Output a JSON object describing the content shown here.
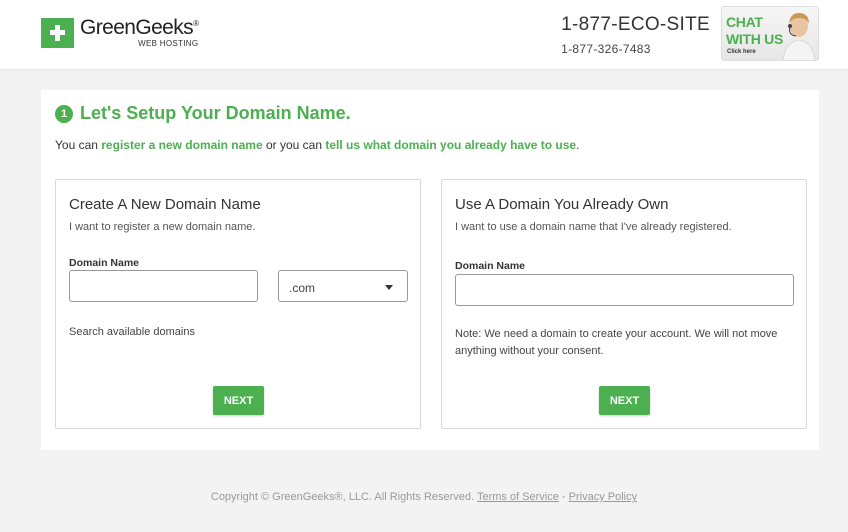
{
  "header": {
    "brand": "GreenGeeks",
    "brand_mark": "®",
    "brand_sub": "WEB HOSTING",
    "phone_main": "1-877-ECO-SITE",
    "phone_alt": "1-877-326-7483",
    "chat_line1": "CHAT",
    "chat_line2": "WITH US",
    "chat_click": "Click here"
  },
  "setup": {
    "step_number": "1",
    "heading": "Let's Setup Your Domain Name.",
    "intro_prefix": "You can ",
    "intro_link1": "register a new domain name",
    "intro_middle": " or you can ",
    "intro_link2": "tell us what domain you already have to use",
    "intro_suffix": "."
  },
  "new_domain": {
    "title": "Create A New Domain Name",
    "subtitle": "I want to register a new domain name.",
    "field_label": "Domain Name",
    "field_value": "",
    "tld_selected": ".com",
    "search_text": "Search available domains",
    "next_label": "NEXT"
  },
  "own_domain": {
    "title": "Use A Domain You Already Own",
    "subtitle": "I want to use a domain name that I've already registered.",
    "field_label": "Domain Name",
    "field_value": "",
    "note_line1": "Note: We need a domain to create your account. We will not move",
    "note_line2": "anything without your consent.",
    "next_label": "NEXT"
  },
  "footer": {
    "copyright": "Copyright © GreenGeeks®, LLC. All Rights Reserved. ",
    "terms": "Terms of Service",
    "separator": " - ",
    "privacy": "Privacy Policy"
  },
  "colors": {
    "accent": "#4caf50",
    "background": "#f3f3f3"
  }
}
